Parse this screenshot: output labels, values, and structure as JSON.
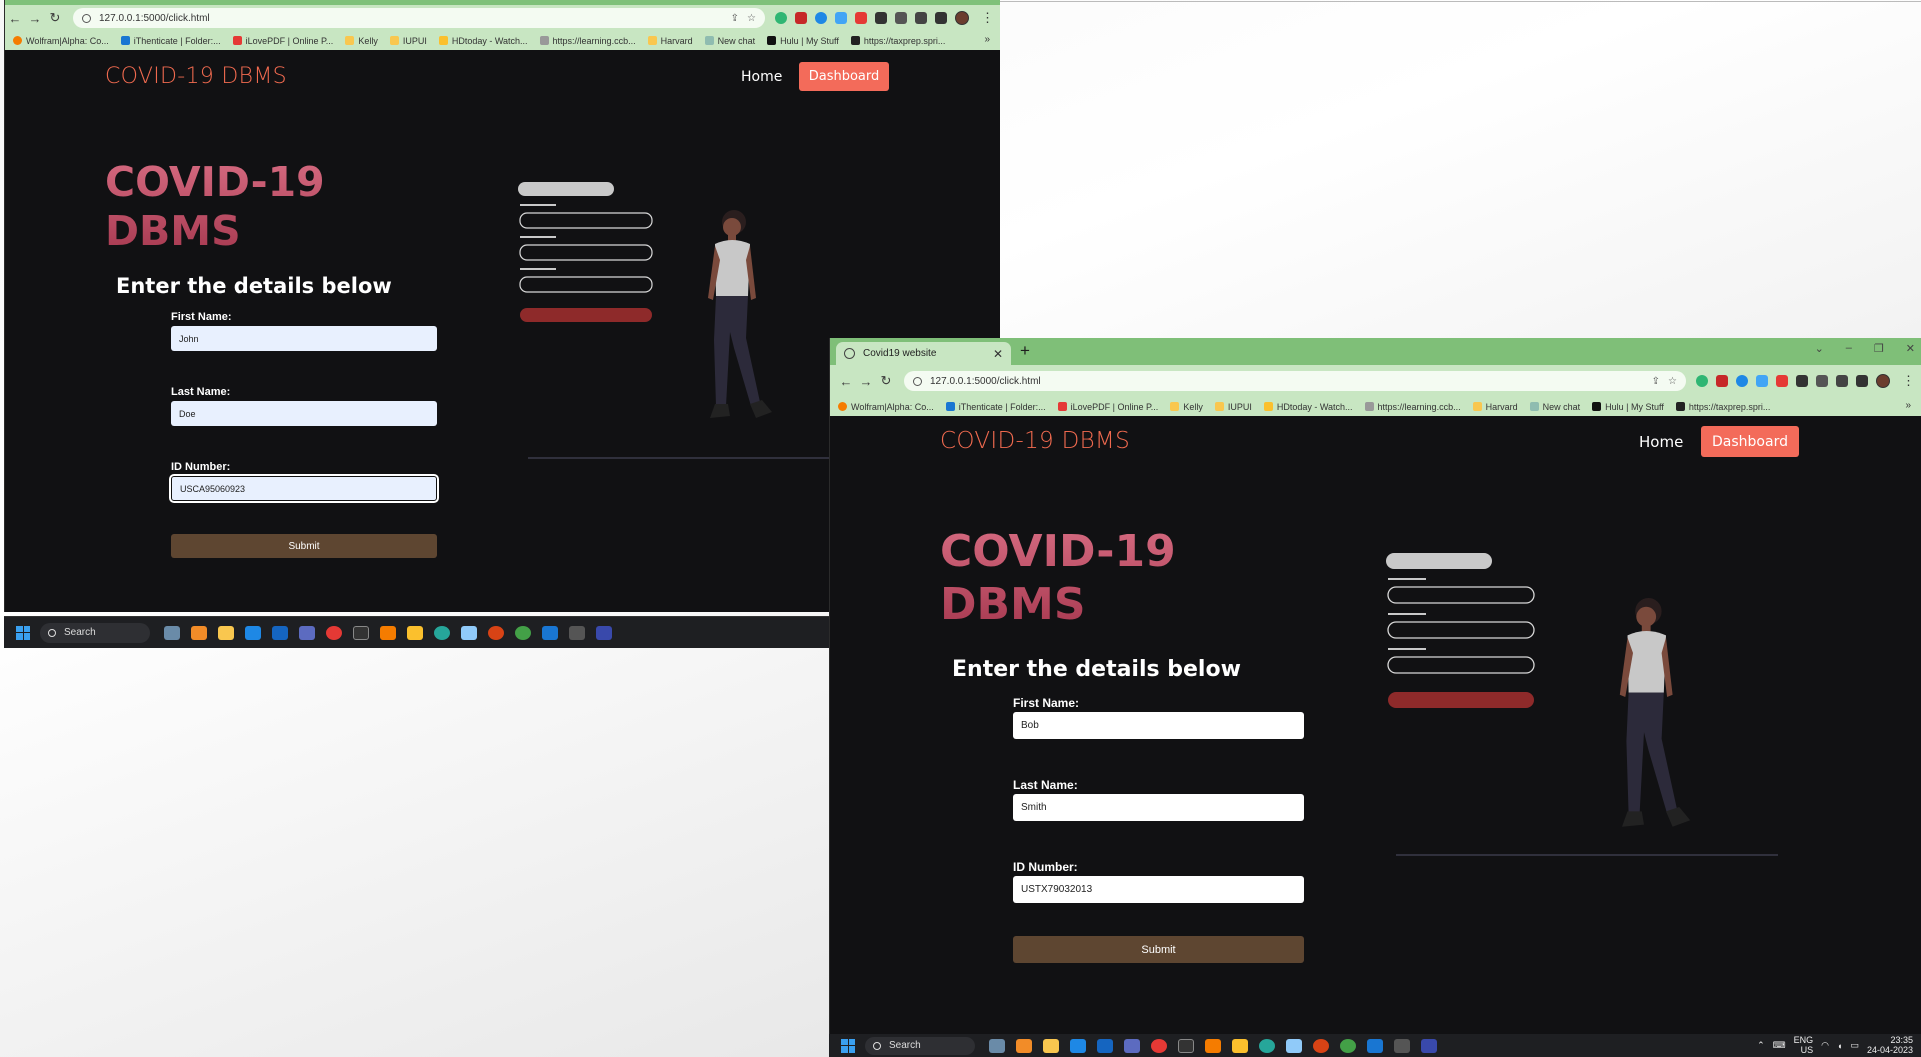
{
  "browser": {
    "url": "127.0.0.1:5000/click.html",
    "tab_title": "Covid19 website",
    "bookmarks": [
      "Wolfram|Alpha: Co...",
      "iThenticate | Folder:...",
      "iLovePDF | Online P...",
      "Kelly",
      "IUPUI",
      "HDtoday - Watch...",
      "https://learning.ccb...",
      "Harvard",
      "New chat",
      "Hulu | My Stuff",
      "https://taxprep.spri..."
    ],
    "bookmarks_more": "»"
  },
  "site": {
    "brand": "COVID-19 DBMS",
    "nav_home": "Home",
    "nav_dashboard": "Dashboard",
    "hero_line1": "COVID-19",
    "hero_line2": "DBMS",
    "form_title": "Enter the details below",
    "first_name_label": "First Name:",
    "last_name_label": "Last Name:",
    "id_label": "ID Number:",
    "submit_label": "Submit"
  },
  "window1_form": {
    "first_name": "John",
    "last_name": "Doe",
    "id_number": "USCA95060923"
  },
  "window2_form": {
    "first_name": "Bob",
    "last_name": "Smith",
    "id_number": "USTX79032013"
  },
  "taskbar": {
    "search_label": "Search",
    "lang_line1": "ENG",
    "lang_line2": "US",
    "time": "23:35",
    "date": "24-04-2023"
  },
  "colors": {
    "brand": "#f06a4f",
    "dashboard_button": "#f36b5a",
    "submit_button": "#5e4631",
    "hero_gradient_top": "#d56a80",
    "hero_gradient_bottom": "#a73950",
    "browser_chrome": "#c8e6c2"
  }
}
